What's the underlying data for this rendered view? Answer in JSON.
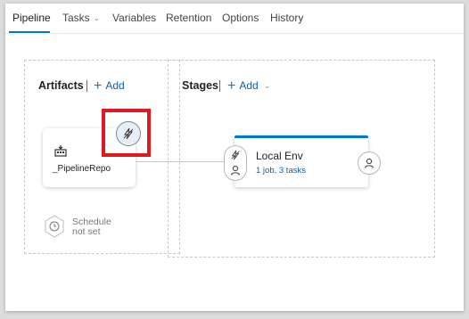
{
  "tabs": [
    {
      "label": "Pipeline",
      "active": true
    },
    {
      "label": "Tasks",
      "has_dropdown": true
    },
    {
      "label": "Variables"
    },
    {
      "label": "Retention"
    },
    {
      "label": "Options"
    },
    {
      "label": "History"
    }
  ],
  "artifacts": {
    "title": "Artifacts",
    "add_label": "Add",
    "item": {
      "name": "_PipelineRepo",
      "icon": "build-artifact-icon"
    },
    "trigger_icon": "lightning-trigger-icon",
    "schedule": {
      "line1": "Schedule",
      "line2": "not set",
      "icon": "clock-icon"
    }
  },
  "stages": {
    "title": "Stages",
    "add_label": "Add",
    "stage": {
      "name": "Local Env",
      "jobs": "1 job, 3 tasks"
    },
    "pre_icons": [
      "lightning-trigger-icon",
      "person-icon"
    ],
    "post_icon": "person-icon"
  },
  "colors": {
    "accent": "#0078d4",
    "highlight": "#e0191f",
    "link": "#0063b1"
  }
}
